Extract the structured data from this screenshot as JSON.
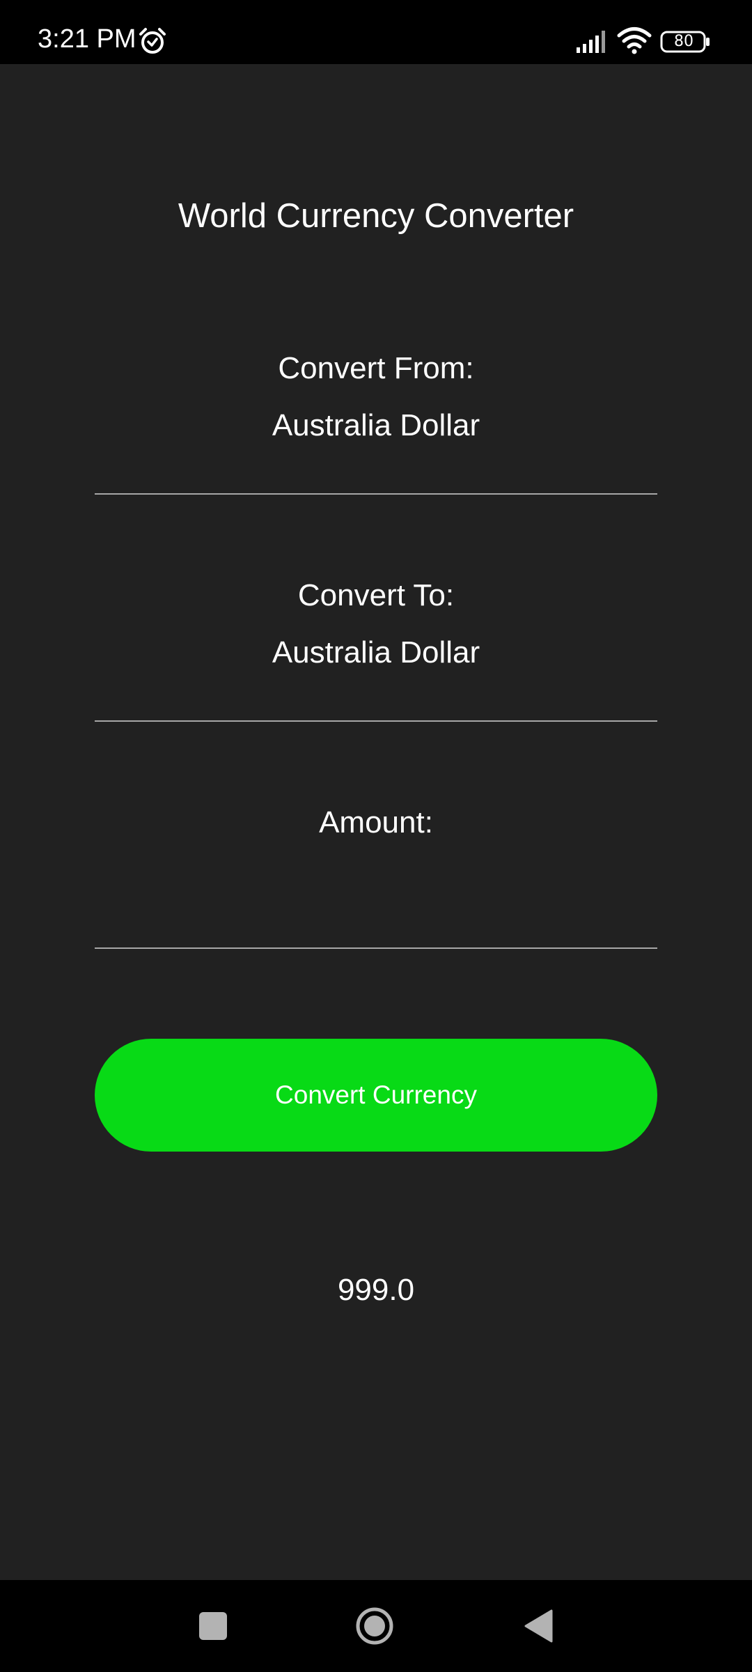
{
  "status_bar": {
    "time": "3:21 PM",
    "battery_level": "80",
    "icons": [
      "alarm-icon",
      "signal-icon",
      "wifi-icon",
      "battery-icon"
    ]
  },
  "app": {
    "title": "World Currency Converter"
  },
  "convert_from": {
    "label": "Convert From:",
    "value": "Australia Dollar"
  },
  "convert_to": {
    "label": "Convert To:",
    "value": "Australia Dollar"
  },
  "amount": {
    "label": "Amount:",
    "value": "",
    "placeholder": ""
  },
  "convert_button": {
    "label": "Convert Currency",
    "color": "#08da16"
  },
  "result": {
    "value": "999.0"
  },
  "nav_bar": {
    "icons": [
      "recents-icon",
      "home-icon",
      "back-icon"
    ]
  },
  "colors": {
    "background": "#212121",
    "bars": "#000000",
    "accent": "#08da16",
    "divider": "#a8a8a8"
  }
}
